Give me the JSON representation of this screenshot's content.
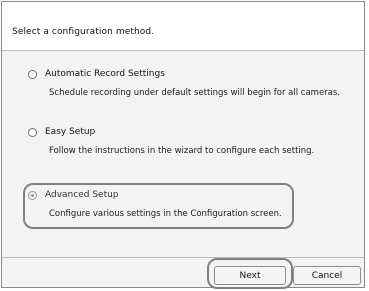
{
  "header": {
    "text": "Select a configuration method."
  },
  "options": [
    {
      "label": "Automatic Record Settings",
      "description": "Schedule recording under default settings will begin for all cameras.",
      "selected": false
    },
    {
      "label": "Easy Setup",
      "description": "Follow the instructions in the wizard to configure each setting.",
      "selected": false
    },
    {
      "label": "Advanced Setup",
      "description": "Configure various settings in the Configuration screen.",
      "selected": true
    }
  ],
  "buttons": {
    "next": "Next",
    "cancel": "Cancel"
  }
}
